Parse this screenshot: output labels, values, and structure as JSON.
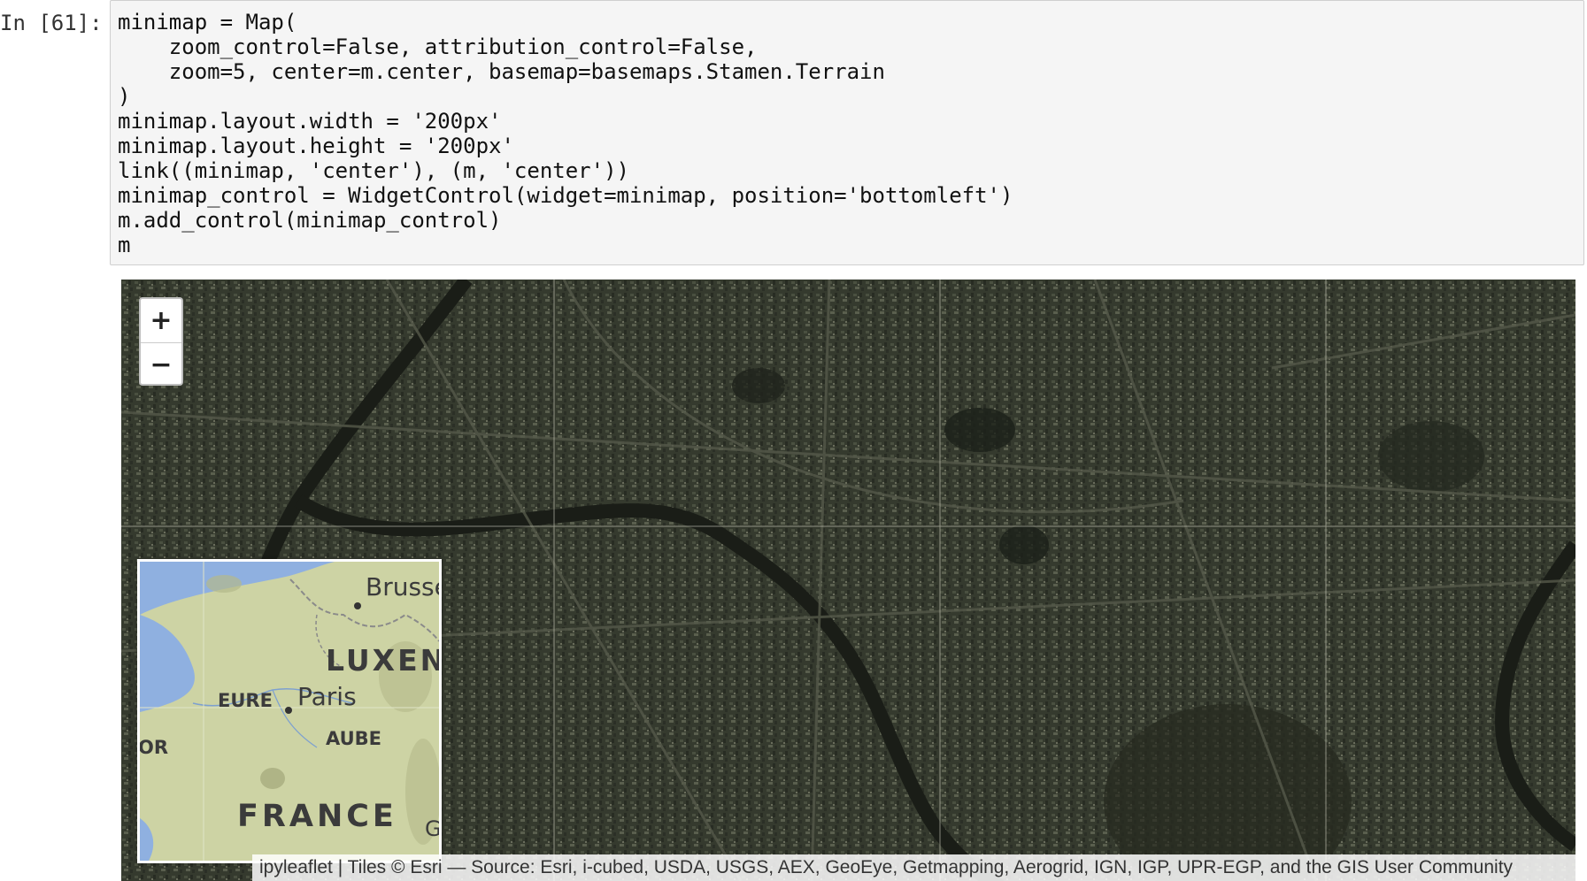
{
  "cell": {
    "prompt": "In [61]:",
    "code_lines": [
      "minimap = Map(",
      "    zoom_control=False, attribution_control=False,",
      "    zoom=5, center=m.center, basemap=basemaps.Stamen.Terrain",
      ")",
      "minimap.layout.width = '200px'",
      "minimap.layout.height = '200px'",
      "link((minimap, 'center'), (m, 'center'))",
      "minimap_control = WidgetControl(widget=minimap, position='bottomleft')",
      "m.add_control(minimap_control)",
      "m"
    ]
  },
  "map": {
    "zoom_in_label": "+",
    "zoom_out_label": "−",
    "attribution": "ipyleaflet | Tiles © Esri — Source: Esri, i-cubed, USDA, USGS, AEX, GeoEye, Getmapping, Aerogrid, IGN, IGP, UPR-EGP, and the GIS User Community",
    "minimap_labels": {
      "brussels": "Brussel",
      "luxembourg": "LUXEN",
      "eure": "EURE",
      "paris": "Paris",
      "aube": "AUBE",
      "france": "FRANCE",
      "or": "OR",
      "g": "G"
    }
  },
  "colors": {
    "satellite_base": "#2f3329",
    "minimap_land": "#cdd3a4",
    "minimap_water": "#8fb0e0",
    "code_bg": "#f5f5f5"
  }
}
